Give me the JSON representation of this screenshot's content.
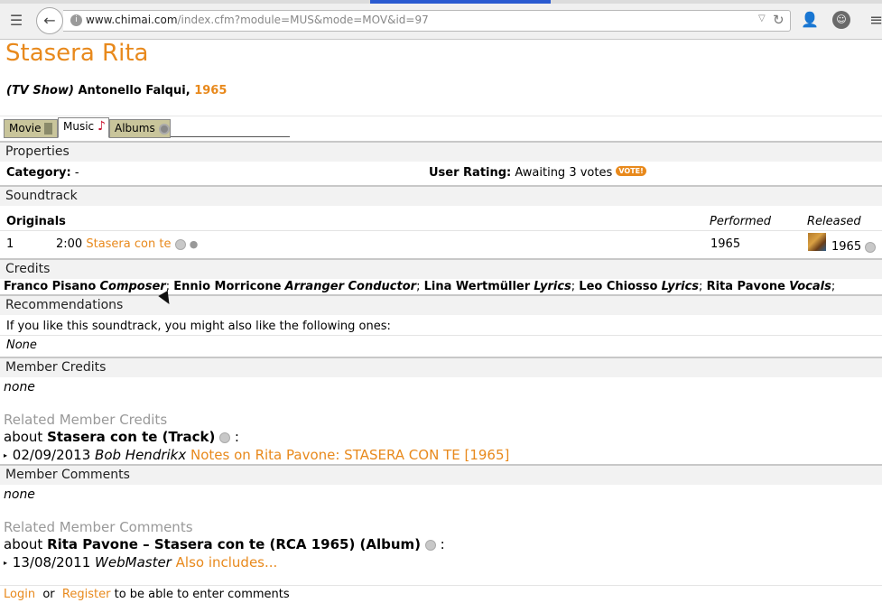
{
  "browser": {
    "url_host": "www.chimai.com",
    "url_path": "/index.cfm?module=MUS&mode=MOV&id=97"
  },
  "page": {
    "title": "Stasera Rita",
    "subtitle_type": "(TV Show)",
    "subtitle_director": "Antonello Falqui,",
    "subtitle_year": "1965"
  },
  "tabs": [
    {
      "label": "Movie"
    },
    {
      "label": "Music"
    },
    {
      "label": "Albums"
    }
  ],
  "properties": {
    "header": "Properties",
    "category_label": "Category:",
    "category_value": "-",
    "rating_label": "User Rating:",
    "rating_value": "Awaiting 3 votes",
    "vote_badge": "VOTE!"
  },
  "soundtrack": {
    "header": "Soundtrack",
    "originals_label": "Originals",
    "col_performed": "Performed",
    "col_released": "Released",
    "rows": [
      {
        "num": "1",
        "duration": "2:00",
        "title": "Stasera con te",
        "performed": "1965",
        "released": "1965"
      }
    ]
  },
  "credits": {
    "header": "Credits",
    "items": [
      {
        "name": "Franco Pisano",
        "role": "Composer"
      },
      {
        "name": "Ennio Morricone",
        "role": "Arranger Conductor"
      },
      {
        "name": "Lina Wertmüller",
        "role": "Lyrics"
      },
      {
        "name": "Leo Chiosso",
        "role": "Lyrics"
      },
      {
        "name": "Rita Pavone",
        "role": "Vocals"
      }
    ]
  },
  "recommendations": {
    "header": "Recommendations",
    "text": "If you like this soundtrack, you might also like the following ones:",
    "value": "None"
  },
  "member_credits": {
    "header": "Member Credits",
    "value": "none",
    "related_header": "Related Member Credits",
    "about_prefix": "about",
    "about_item": "Stasera con te (Track)",
    "about_suffix": ":",
    "entry_date": "02/09/2013",
    "entry_author": "Bob Hendrikx",
    "entry_link": "Notes on Rita Pavone: STASERA CON TE [1965]"
  },
  "member_comments": {
    "header": "Member Comments",
    "value": "none",
    "related_header": "Related Member Comments",
    "about_prefix": "about",
    "about_item": "Rita Pavone – Stasera con te (RCA 1965) (Album)",
    "about_suffix": ":",
    "entry_date": "13/08/2011",
    "entry_author": "WebMaster",
    "entry_link": "Also includes..."
  },
  "footer": {
    "login": "Login",
    "or": "or",
    "register": "Register",
    "suffix": "to be able to enter comments"
  }
}
